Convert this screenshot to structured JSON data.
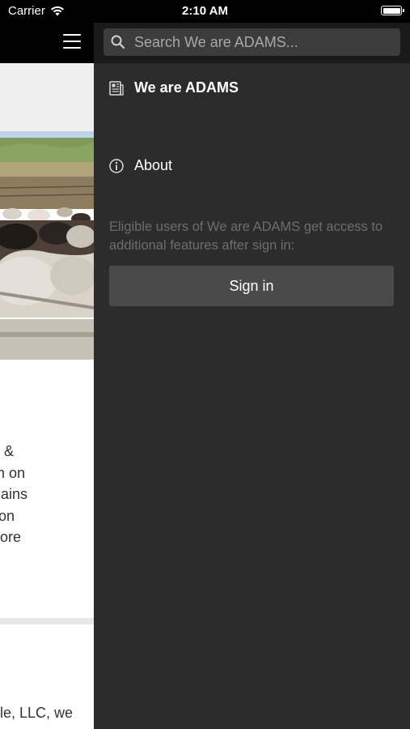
{
  "status_bar": {
    "carrier": "Carrier",
    "time": "2:10 AM",
    "battery_level": 1.0,
    "icons": [
      "wifi-icon",
      "battery-icon"
    ]
  },
  "content": {
    "menu_icon": "hamburger-icon",
    "text_lines": [
      "and &",
      " farm on",
      "remains",
      "cation",
      "d more"
    ],
    "text_bottom": "le, LLC, we"
  },
  "drawer": {
    "search": {
      "placeholder": "Search We are ADAMS..."
    },
    "items": [
      {
        "label": "We are ADAMS",
        "icon": "news-icon"
      },
      {
        "label": "About",
        "icon": "info-icon"
      }
    ],
    "eligible_text": "Eligible users of We are ADAMS get access to additional features after sign in:",
    "signin_label": "Sign in"
  },
  "colors": {
    "drawer_bg": "#2c2c2c",
    "search_bar_bg": "#1a1a1a",
    "button_bg": "#4a4a4a",
    "muted_text": "#6d6d6d"
  }
}
